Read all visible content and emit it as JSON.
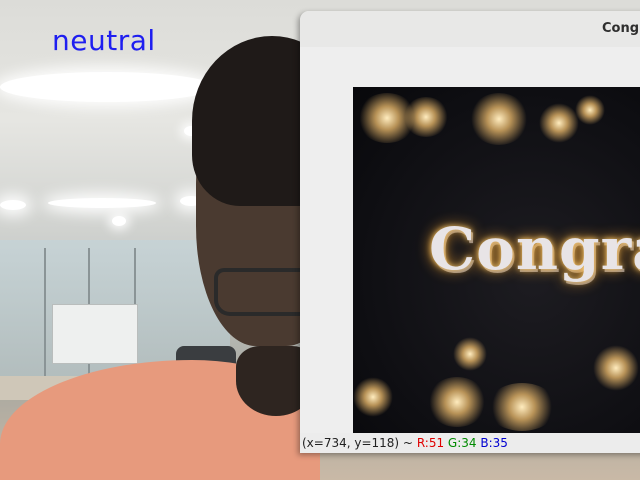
{
  "overlay": {
    "emotion_label": "neutral",
    "emotion_color": "#1e1ef0"
  },
  "window": {
    "title": "Congr",
    "image": {
      "text": "Congrat"
    },
    "status": {
      "coords": "(x=734, y=118) ~",
      "r": "R:51",
      "g": "G:34",
      "b": "B:35"
    }
  },
  "colors": {
    "status_r": "#e00000",
    "status_g": "#008a00",
    "status_b": "#0000d0"
  }
}
